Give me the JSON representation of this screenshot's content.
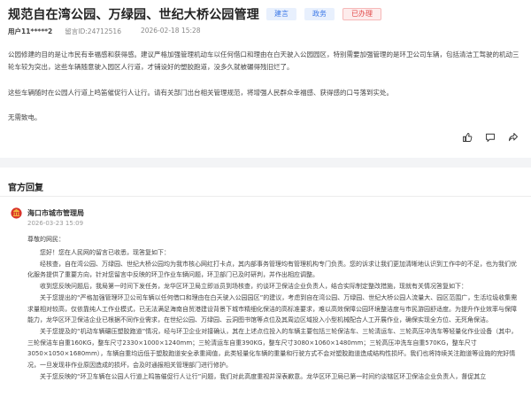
{
  "question": {
    "title": "规范自在湾公园、万绿园、世纪大桥公园管理",
    "tags": [
      "建言",
      "政务",
      "已办理"
    ],
    "user": "用户11*****2",
    "message_id": "留言ID:24712516",
    "datetime": "2026-02-18 15:28",
    "paragraphs": [
      "公园修建的目的是让市民有幸福感和获得感。建议严格加强管理机动车以任何借口和理由在白天驶入公园园区，特别需要加强管理的是环卫公司车辆，包括清洁工驾驶的机动三轮车较为突出，这些车辆随意驶入园区人行道，才铺设好的塑胶跑道，没多久就被碾得残旧烂了。",
      "这些车辆随时在公园人行道上鸣笛催促行人让行。请有关部门出台相关管理规范，将增强人民群众幸福感、获得感的口号落到实处。",
      "无需致电。"
    ],
    "actions": [
      "thumb-up-icon",
      "chat-icon",
      "share-icon"
    ]
  },
  "reply_section": {
    "title": "官方回复",
    "org": "海口市城市管理局",
    "date": "2026-03-23 15:09",
    "greeting": "尊敬的网民：",
    "body": "您好！您在人民网的留言已收悉，现答复如下：\n经核查，自在湾公园、万绿园、世纪大桥公园均为我市核心网红打卡点，其内部事务管理均有管理机构专门负责。您的诉求让我们更加清晰地认识到工作中的不足，也为我们优化服务提供了重要方向，针对您留言中反映的环卫作业车辆问题，环卫部门已及时研判，并作出相应调整。\n收到您反映问题后，我局第一时间下发任务，龙华区环卫局立即派员到场核查，约谈环卫保洁企业负责人，结合实际制定整改措施，现就有关情况答复如下：\n关于您提出的“严格加强管理环卫公司车辆以任何借口和理由在白天驶入公园园区”的建议，考虑到自在湾公园、万绿园、世纪大桥公园人流量大、园区范围广，生活垃圾收集需求量相对较高，仅依靠纯人工作业模式，已无法满足海南自贸港建设背景下城市精细化保洁的高标准要求，难以高效保障公园环境整洁度与市民游园舒适度。为提升作业效率与保障能力，龙华区环卫保洁企业已根据不同作业需求，在世纪公园、万绿园、云洞图书馆等点位及其周边区域投入小型机械配合人工开展作业，确保实现全方位、无死角保洁。\n关于您提及的“机动车辆碾压塑胶跑道”情况，经与环卫企业对接确认，其在上述点位投入的车辆主要包括三轮保洁车、三轮清运车、三轮高压冲洗车等轻量化作业设备（其中，三轮保洁车自重160KG，整车尺寸2330×1000×1240mm；三轮清运车自重390KG，整车尺寸3080×1060×1480mm；三轮高压冲洗车自重570KG，整车尺寸3050×1050×1680mm），车辆自重均远低于塑胶跑道安全承重阈值，此类轻量化车辆的重量和行驶方式不会对塑胶跑道造成结构性损坏。我们也将持续关注跑道等设施的完好情况，一旦发现非作业原因造成的损坏，会及时通报相关管理部门进行修护。\n关于您反映的“环卫车辆在公园人行道上鸣笛催促行人让行”问题，我们对此高度重视并深表歉意。龙华区环卫局已第一时间约谈辖区环卫保洁企业负责人，督促其立"
  }
}
